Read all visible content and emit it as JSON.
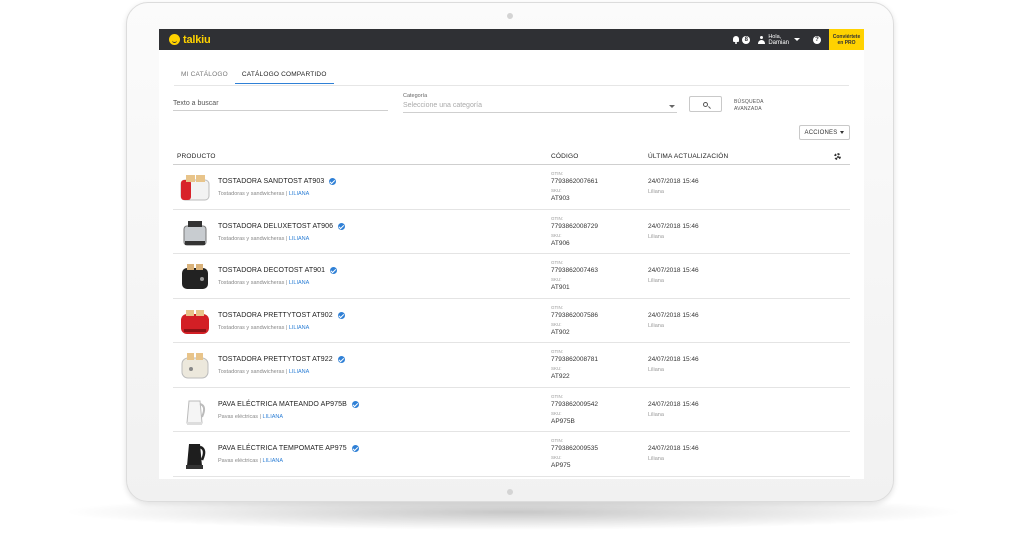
{
  "colors": {
    "topbar": "#2f3034",
    "brand_yellow": "#ffd200",
    "accent_blue": "#2f80d6"
  },
  "topbar": {
    "logo_text": "talkiu",
    "notification_count": "8",
    "greeting": "Hola,",
    "user_name": "Damian",
    "help_label": "?",
    "pro_line1": "Conviértete",
    "pro_line2": "en PRO"
  },
  "tabs": [
    {
      "label": "MI CATÁLOGO",
      "active": false
    },
    {
      "label": "CATÁLOGO COMPARTIDO",
      "active": true
    }
  ],
  "filters": {
    "search_text": "Texto a buscar",
    "category_label": "Categoría",
    "category_placeholder": "Seleccione una categoría",
    "advanced_line1": "BÚSQUEDA",
    "advanced_line2": "AVANZADA",
    "actions_label": "ACCIONES"
  },
  "table": {
    "headers": {
      "product": "PRODUCTO",
      "code": "CÓDIGO",
      "updated": "ÚLTIMA ACTUALIZACIÓN"
    },
    "gtin_label": "GTIN:",
    "sku_label": "SKU:",
    "rows": [
      {
        "name": "TOSTADORA SANDTOST AT903",
        "category": "Tostadoras y sandwicheras",
        "brand": "LILIANA",
        "gtin": "7793862007661",
        "sku": "AT903",
        "date": "24/07/2018 15:46",
        "user": "Liliana",
        "thumb": "toaster-red-white"
      },
      {
        "name": "TOSTADORA DELUXETOST AT906",
        "category": "Tostadoras y sandwicheras",
        "brand": "LILIANA",
        "gtin": "7793862008729",
        "sku": "AT906",
        "date": "24/07/2018 15:46",
        "user": "Liliana",
        "thumb": "toaster-steel"
      },
      {
        "name": "TOSTADORA DECOTOST AT901",
        "category": "Tostadoras y sandwicheras",
        "brand": "LILIANA",
        "gtin": "7793862007463",
        "sku": "AT901",
        "date": "24/07/2018 15:46",
        "user": "Liliana",
        "thumb": "toaster-black"
      },
      {
        "name": "TOSTADORA PRETTYTOST AT902",
        "category": "Tostadoras y sandwicheras",
        "brand": "LILIANA",
        "gtin": "7793862007586",
        "sku": "AT902",
        "date": "24/07/2018 15:46",
        "user": "Liliana",
        "thumb": "toaster-red"
      },
      {
        "name": "TOSTADORA PRETTYTOST AT922",
        "category": "Tostadoras y sandwicheras",
        "brand": "LILIANA",
        "gtin": "7793862008781",
        "sku": "AT922",
        "date": "24/07/2018 15:46",
        "user": "Liliana",
        "thumb": "toaster-cream"
      },
      {
        "name": "PAVA ELÉCTRICA MATEANDO AP975B",
        "category": "Pavas eléctricas",
        "brand": "LILIANA",
        "gtin": "7793862009542",
        "sku": "AP975B",
        "date": "24/07/2018 15:46",
        "user": "Liliana",
        "thumb": "kettle-white"
      },
      {
        "name": "PAVA ELÉCTRICA TEMPOMATE AP975",
        "category": "Pavas eléctricas",
        "brand": "LILIANA",
        "gtin": "7793862009535",
        "sku": "AP975",
        "date": "24/07/2018 15:46",
        "user": "Liliana",
        "thumb": "kettle-black"
      }
    ]
  }
}
